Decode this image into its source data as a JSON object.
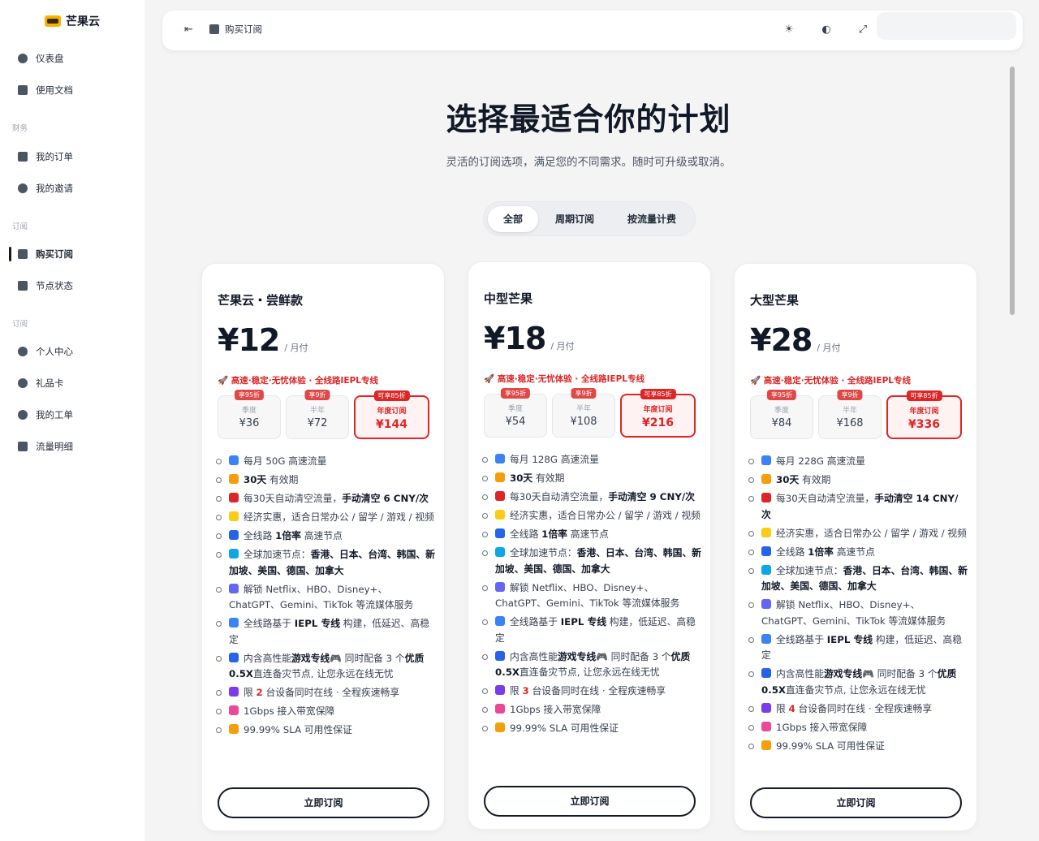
{
  "brand": {
    "name": "芒果云"
  },
  "sidebar": {
    "items": [
      {
        "label": "仪表盘",
        "icon": "dashboard-icon"
      },
      {
        "label": "使用文档",
        "icon": "doc-icon"
      },
      {
        "label": "我的订单",
        "icon": "order-icon"
      },
      {
        "label": "我的邀请",
        "icon": "invite-icon"
      },
      {
        "label": "购买订阅",
        "icon": "shop-icon",
        "active": true
      },
      {
        "label": "节点状态",
        "icon": "server-icon"
      },
      {
        "label": "个人中心",
        "icon": "user-icon"
      },
      {
        "label": "礼品卡",
        "icon": "gift-icon"
      },
      {
        "label": "我的工单",
        "icon": "ticket-icon"
      },
      {
        "label": "流量明细",
        "icon": "chart-icon"
      }
    ],
    "sections": [
      "财务",
      "订阅",
      "订阅"
    ]
  },
  "header": {
    "title": "购买订阅"
  },
  "hero": {
    "title": "选择最适合你的计划",
    "subtitle": "灵活的订阅选项，满足您的不同需求。随时可升级或取消。"
  },
  "tabs": [
    "全部",
    "周期订阅",
    "按流量计费"
  ],
  "plans": [
    {
      "name": "芒果云・尝鲜款",
      "price": "¥12",
      "unit": "/ 月付",
      "promo": "🚀 高速·稳定·无忧体验 · 全线路IEPL专线",
      "options": [
        {
          "tag": "享95折",
          "label": "季度",
          "amount": "¥36"
        },
        {
          "tag": "享9折",
          "label": "半年",
          "amount": "¥72"
        },
        {
          "tag": "可享85折",
          "label": "年度订阅",
          "amount": "¥144"
        }
      ],
      "features": {
        "f1": "每月 50G 高速流量",
        "f2_b": "30天",
        "f2": " 有效期",
        "f3": "每30天自动清空流量，",
        "f3_b": "手动清空 6 CNY/次",
        "f4": "经济实惠，适合日常办公 / 留学 / 游戏 / 视频",
        "f5": "全线路 ",
        "f5_b": "1倍率",
        "f5_t": " 高速节点",
        "f6": "全球加速节点：",
        "f6_b": "香港、日本、台湾、韩国、新加坡、美国、德国、加拿大",
        "f7": "解锁 Netflix、HBO、Disney+、ChatGPT、Gemini、TikTok 等流媒体服务",
        "f8": "全线路基于 ",
        "f8_b": "IEPL 专线",
        "f8_t": " 构建，低延迟、高稳定",
        "f9": "内含高性能",
        "f9_b": "游戏专线",
        "f9_t": "🎮 同时配备 3 个",
        "f9_b2": "优质0.5X",
        "f9_t2": "直连备灾节点, 让您永远在线无忧",
        "f10": "限 ",
        "f10_hl": "2",
        "f10_t": " 台设备同时在线 · 全程疾速畅享",
        "f11": "1Gbps 接入带宽保障",
        "f12": "99.99% SLA 可用性保证"
      },
      "button": "立即订阅"
    },
    {
      "name": "中型芒果",
      "price": "¥18",
      "unit": "/ 月付",
      "promo": "🚀 高速·稳定·无忧体验 · 全线路IEPL专线",
      "options": [
        {
          "tag": "享95折",
          "label": "季度",
          "amount": "¥54"
        },
        {
          "tag": "享9折",
          "label": "半年",
          "amount": "¥108"
        },
        {
          "tag": "可享85折",
          "label": "年度订阅",
          "amount": "¥216"
        }
      ],
      "features": {
        "f1": "每月 128G 高速流量",
        "f2_b": "30天",
        "f2": " 有效期",
        "f3": "每30天自动清空流量，",
        "f3_b": "手动清空 9 CNY/次",
        "f4": "经济实惠，适合日常办公 / 留学 / 游戏 / 视频",
        "f5": "全线路 ",
        "f5_b": "1倍率",
        "f5_t": " 高速节点",
        "f6": "全球加速节点：",
        "f6_b": "香港、日本、台湾、韩国、新加坡、美国、德国、加拿大",
        "f7": "解锁 Netflix、HBO、Disney+、ChatGPT、Gemini、TikTok 等流媒体服务",
        "f8": "全线路基于 ",
        "f8_b": "IEPL 专线",
        "f8_t": " 构建，低延迟、高稳定",
        "f9": "内含高性能",
        "f9_b": "游戏专线",
        "f9_t": "🎮 同时配备 3 个",
        "f9_b2": "优质0.5X",
        "f9_t2": "直连备灾节点, 让您永远在线无忧",
        "f10": "限 ",
        "f10_hl": "3",
        "f10_t": " 台设备同时在线 · 全程疾速畅享",
        "f11": "1Gbps 接入带宽保障",
        "f12": "99.99% SLA 可用性保证"
      },
      "button": "立即订阅"
    },
    {
      "name": "大型芒果",
      "price": "¥28",
      "unit": "/ 月付",
      "promo": "🚀 高速·稳定·无忧体验 · 全线路IEPL专线",
      "options": [
        {
          "tag": "享95折",
          "label": "季度",
          "amount": "¥84"
        },
        {
          "tag": "享9折",
          "label": "半年",
          "amount": "¥168"
        },
        {
          "tag": "可享85折",
          "label": "年度订阅",
          "amount": "¥336"
        }
      ],
      "features": {
        "f1": "每月 228G 高速流量",
        "f2_b": "30天",
        "f2": " 有效期",
        "f3": "每30天自动清空流量，",
        "f3_b": "手动清空 14 CNY/次",
        "f4": "经济实惠，适合日常办公 / 留学 / 游戏 / 视频",
        "f5": "全线路 ",
        "f5_b": "1倍率",
        "f5_t": " 高速节点",
        "f6": "全球加速节点：",
        "f6_b": "香港、日本、台湾、韩国、新加坡、美国、德国、加拿大",
        "f7": "解锁 Netflix、HBO、Disney+、ChatGPT、Gemini、TikTok 等流媒体服务",
        "f8": "全线路基于 ",
        "f8_b": "IEPL 专线",
        "f8_t": " 构建，低延迟、高稳定",
        "f9": "内含高性能",
        "f9_b": "游戏专线",
        "f9_t": "🎮 同时配备 3 个",
        "f9_b2": "优质0.5X",
        "f9_t2": "直连备灾节点, 让您永远在线无忧",
        "f10": "限 ",
        "f10_hl": "4",
        "f10_t": " 台设备同时在线 · 全程疾速畅享",
        "f11": "1Gbps 接入带宽保障",
        "f12": "99.99% SLA 可用性保证"
      },
      "button": "立即订阅"
    }
  ],
  "colors": {
    "accent": "#dc2626",
    "text": "#111827",
    "background": "#f4f4f5"
  }
}
